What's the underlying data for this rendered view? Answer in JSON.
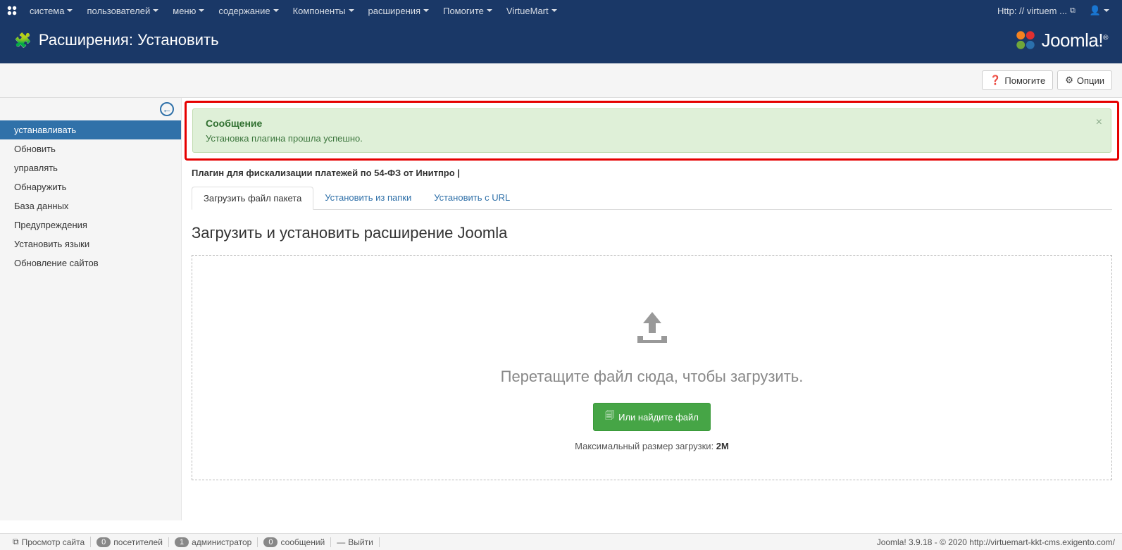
{
  "topmenu": {
    "items": [
      "система",
      "пользователей",
      "меню",
      "содержание",
      "Компоненты",
      "расширения",
      "Помогите",
      "VirtueMart"
    ],
    "site_link": "Http: // virtuem ..."
  },
  "header": {
    "title": "Расширения: Установить"
  },
  "toolbar": {
    "help": "Помогите",
    "options": "Опции"
  },
  "sidebar": {
    "items": [
      "устанавливать",
      "Обновить",
      "управлять",
      "Обнаружить",
      "База данных",
      "Предупреждения",
      "Установить языки",
      "Обновление сайтов"
    ],
    "active_index": 0
  },
  "alert": {
    "title": "Сообщение",
    "text": "Установка плагина прошла успешно."
  },
  "plugin_note": "Плагин для фискализации платежей по 54-ФЗ от Инитпро |",
  "tabs": {
    "items": [
      "Загрузить файл пакета",
      "Установить из папки",
      "Установить с URL"
    ],
    "active_index": 0
  },
  "upload": {
    "section_title": "Загрузить и установить расширение Joomla",
    "drop_text": "Перетащите файл сюда, чтобы загрузить.",
    "browse_btn": "Или найдите файл",
    "maxsize_label": "Максимальный размер загрузки: ",
    "maxsize_value": "2M"
  },
  "footer": {
    "view_site": "Просмотр сайта",
    "visitors_count": "0",
    "visitors_label": "посетителей",
    "admin_count": "1",
    "admin_label": "администратор",
    "messages_count": "0",
    "messages_label": "сообщений",
    "logout": "Выйти",
    "copyright": "Joomla! 3.9.18 - © 2020 http://virtuemart-kkt-cms.exigento.com/"
  }
}
